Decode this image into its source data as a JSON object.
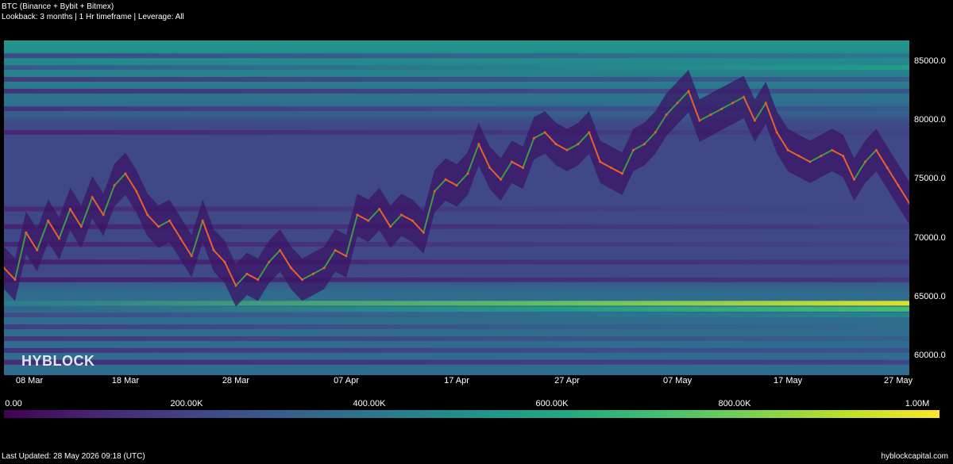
{
  "header": {
    "title": "BTC (Binance + Bybit + Bitmex)",
    "subtitle": "Lookback: 3 months | 1 Hr timeframe | Leverage: All"
  },
  "watermark": "HYBLOCK",
  "footer": {
    "last_updated": "Last Updated: 28 May 2026 09:18 (UTC)",
    "site": "hyblockcapital.com"
  },
  "colors": {
    "background": "#000000",
    "price_up": "#3f9a46",
    "price_down": "#e8602c",
    "colormap": [
      "#440154",
      "#482475",
      "#414487",
      "#355f8d",
      "#2a788e",
      "#21918c",
      "#22a884",
      "#44bf70",
      "#7ad151",
      "#bddf26",
      "#fde725"
    ]
  },
  "chart_data": {
    "type": "heatmap",
    "title": "BTC (Binance + Bybit + Bitmex)",
    "ylim": [
      58400,
      86800
    ],
    "xlim": [
      "2026-03-07",
      "2026-05-28"
    ],
    "y_ticks": [
      "60000.0",
      "65000.0",
      "70000.0",
      "75000.0",
      "80000.0",
      "85000.0"
    ],
    "x_ticks": [
      {
        "label": "08 Mar",
        "date": "2026-03-08"
      },
      {
        "label": "18 Mar",
        "date": "2026-03-18"
      },
      {
        "label": "28 Mar",
        "date": "2026-03-28"
      },
      {
        "label": "07 Apr",
        "date": "2026-04-07"
      },
      {
        "label": "17 Apr",
        "date": "2026-04-17"
      },
      {
        "label": "27 Apr",
        "date": "2026-04-27"
      },
      {
        "label": "07 May",
        "date": "2026-05-07"
      },
      {
        "label": "17 May",
        "date": "2026-05-17"
      },
      {
        "label": "27 May",
        "date": "2026-05-27"
      }
    ],
    "colorbar": {
      "min": 0,
      "max": 1000000,
      "ticks": [
        "0.00",
        "200.00K",
        "400.00K",
        "600.00K",
        "800.00K",
        "1.00M"
      ]
    },
    "liquidation_bands": [
      {
        "price": 64500,
        "value": 950000
      },
      {
        "price": 64000,
        "value": 700000
      },
      {
        "price": 63500,
        "value": 450000
      },
      {
        "price": 62500,
        "value": 350000
      },
      {
        "price": 61500,
        "value": 300000
      },
      {
        "price": 60500,
        "value": 260000
      },
      {
        "price": 59500,
        "value": 200000
      },
      {
        "price": 84500,
        "value": 550000
      },
      {
        "price": 85500,
        "value": 400000
      },
      {
        "price": 83500,
        "value": 300000
      },
      {
        "price": 82500,
        "value": 250000
      },
      {
        "price": 81000,
        "value": 280000
      },
      {
        "price": 79000,
        "value": 200000
      },
      {
        "price": 72500,
        "value": 220000
      },
      {
        "price": 71000,
        "value": 180000
      },
      {
        "price": 69500,
        "value": 200000
      },
      {
        "price": 68000,
        "value": 160000
      },
      {
        "price": 66500,
        "value": 150000
      }
    ],
    "price_series": [
      {
        "date": "2026-03-07",
        "price": 67500
      },
      {
        "date": "2026-03-08",
        "price": 66500
      },
      {
        "date": "2026-03-09",
        "price": 70500
      },
      {
        "date": "2026-03-10",
        "price": 69000
      },
      {
        "date": "2026-03-11",
        "price": 71500
      },
      {
        "date": "2026-03-12",
        "price": 70000
      },
      {
        "date": "2026-03-13",
        "price": 72500
      },
      {
        "date": "2026-03-14",
        "price": 71000
      },
      {
        "date": "2026-03-15",
        "price": 73500
      },
      {
        "date": "2026-03-16",
        "price": 72000
      },
      {
        "date": "2026-03-17",
        "price": 74500
      },
      {
        "date": "2026-03-18",
        "price": 75500
      },
      {
        "date": "2026-03-19",
        "price": 74000
      },
      {
        "date": "2026-03-20",
        "price": 72000
      },
      {
        "date": "2026-03-21",
        "price": 71000
      },
      {
        "date": "2026-03-22",
        "price": 71500
      },
      {
        "date": "2026-03-23",
        "price": 70000
      },
      {
        "date": "2026-03-24",
        "price": 68500
      },
      {
        "date": "2026-03-25",
        "price": 71500
      },
      {
        "date": "2026-03-26",
        "price": 69000
      },
      {
        "date": "2026-03-27",
        "price": 68000
      },
      {
        "date": "2026-03-28",
        "price": 66000
      },
      {
        "date": "2026-03-29",
        "price": 67000
      },
      {
        "date": "2026-03-30",
        "price": 66500
      },
      {
        "date": "2026-03-31",
        "price": 68000
      },
      {
        "date": "2026-04-01",
        "price": 69000
      },
      {
        "date": "2026-04-02",
        "price": 67500
      },
      {
        "date": "2026-04-03",
        "price": 66500
      },
      {
        "date": "2026-04-04",
        "price": 67000
      },
      {
        "date": "2026-04-05",
        "price": 67500
      },
      {
        "date": "2026-04-06",
        "price": 69000
      },
      {
        "date": "2026-04-07",
        "price": 68500
      },
      {
        "date": "2026-04-08",
        "price": 72000
      },
      {
        "date": "2026-04-09",
        "price": 71500
      },
      {
        "date": "2026-04-10",
        "price": 72500
      },
      {
        "date": "2026-04-11",
        "price": 71000
      },
      {
        "date": "2026-04-12",
        "price": 72000
      },
      {
        "date": "2026-04-13",
        "price": 71500
      },
      {
        "date": "2026-04-14",
        "price": 70500
      },
      {
        "date": "2026-04-15",
        "price": 74000
      },
      {
        "date": "2026-04-16",
        "price": 75000
      },
      {
        "date": "2026-04-17",
        "price": 74500
      },
      {
        "date": "2026-04-18",
        "price": 75500
      },
      {
        "date": "2026-04-19",
        "price": 78000
      },
      {
        "date": "2026-04-20",
        "price": 76000
      },
      {
        "date": "2026-04-21",
        "price": 75000
      },
      {
        "date": "2026-04-22",
        "price": 76500
      },
      {
        "date": "2026-04-23",
        "price": 76000
      },
      {
        "date": "2026-04-24",
        "price": 78500
      },
      {
        "date": "2026-04-25",
        "price": 79000
      },
      {
        "date": "2026-04-26",
        "price": 78000
      },
      {
        "date": "2026-04-27",
        "price": 77500
      },
      {
        "date": "2026-04-28",
        "price": 78000
      },
      {
        "date": "2026-04-29",
        "price": 79000
      },
      {
        "date": "2026-04-30",
        "price": 76500
      },
      {
        "date": "2026-05-01",
        "price": 76000
      },
      {
        "date": "2026-05-02",
        "price": 75500
      },
      {
        "date": "2026-05-03",
        "price": 77500
      },
      {
        "date": "2026-05-04",
        "price": 78000
      },
      {
        "date": "2026-05-05",
        "price": 79000
      },
      {
        "date": "2026-05-06",
        "price": 80500
      },
      {
        "date": "2026-05-07",
        "price": 81500
      },
      {
        "date": "2026-05-08",
        "price": 82500
      },
      {
        "date": "2026-05-09",
        "price": 80000
      },
      {
        "date": "2026-05-10",
        "price": 80500
      },
      {
        "date": "2026-05-11",
        "price": 81000
      },
      {
        "date": "2026-05-12",
        "price": 81500
      },
      {
        "date": "2026-05-13",
        "price": 82000
      },
      {
        "date": "2026-05-14",
        "price": 80000
      },
      {
        "date": "2026-05-15",
        "price": 81500
      },
      {
        "date": "2026-05-16",
        "price": 79000
      },
      {
        "date": "2026-05-17",
        "price": 77500
      },
      {
        "date": "2026-05-18",
        "price": 77000
      },
      {
        "date": "2026-05-19",
        "price": 76500
      },
      {
        "date": "2026-05-20",
        "price": 77000
      },
      {
        "date": "2026-05-21",
        "price": 77500
      },
      {
        "date": "2026-05-22",
        "price": 77000
      },
      {
        "date": "2026-05-23",
        "price": 75000
      },
      {
        "date": "2026-05-24",
        "price": 76500
      },
      {
        "date": "2026-05-25",
        "price": 77500
      },
      {
        "date": "2026-05-26",
        "price": 76000
      },
      {
        "date": "2026-05-27",
        "price": 74500
      },
      {
        "date": "2026-05-28",
        "price": 73000
      }
    ]
  }
}
